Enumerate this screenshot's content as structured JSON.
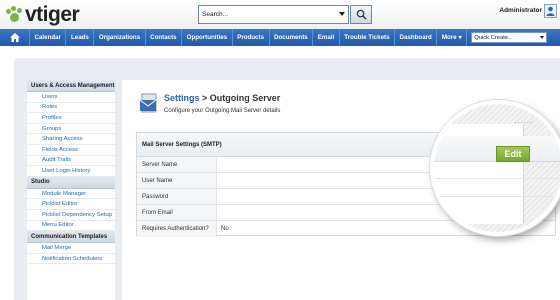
{
  "header": {
    "logo_text": "vtiger",
    "search_value": "Search...",
    "user_name": "Administrator"
  },
  "nav": {
    "items": [
      "Calendar",
      "Leads",
      "Organizations",
      "Contacts",
      "Opportunities",
      "Products",
      "Documents",
      "Email",
      "Trouble Tickets",
      "Dashboard",
      "More"
    ],
    "more_caret": "▾",
    "quick_create": "Quick Create..."
  },
  "sidebar": {
    "sections": [
      {
        "title": "Users & Access Management",
        "items": [
          "Users",
          "Roles",
          "Profiles",
          "Groups",
          "Sharing Access",
          "Fields Access",
          "Audit Trails",
          "User Login History"
        ]
      },
      {
        "title": "Studio",
        "items": [
          "Module Manager",
          "Picklist Editor",
          "Picklist Dependency Setup",
          "Menu Editor"
        ]
      },
      {
        "title": "Communication Templates",
        "items": [
          "Mail Merge",
          "Notification Schedulers"
        ]
      }
    ]
  },
  "main": {
    "breadcrumb_link": "Settings",
    "breadcrumb_separator": " > ",
    "breadcrumb_current": "Outgoing Server",
    "subtitle": "Configure your Outgoing Mail Server details",
    "card_title": "Mail Server Settings (SMTP)",
    "fields": [
      {
        "label": "Server Name",
        "value": ""
      },
      {
        "label": "User Name",
        "value": ""
      },
      {
        "label": "Password",
        "value": ""
      },
      {
        "label": "From Email",
        "value": ""
      },
      {
        "label": "Requires Authentication?",
        "value": "No"
      }
    ],
    "edit_label": "Edit",
    "magnifier_dots": "......"
  },
  "colors": {
    "nav_blue": "#2a68b5",
    "link_blue": "#2366b5",
    "edit_green": "#8cb845",
    "logo_green": "#7cb342"
  },
  "icons": {
    "home": "home-icon",
    "search": "magnifier-icon",
    "user": "user-icon",
    "mail": "mail-server-icon"
  }
}
